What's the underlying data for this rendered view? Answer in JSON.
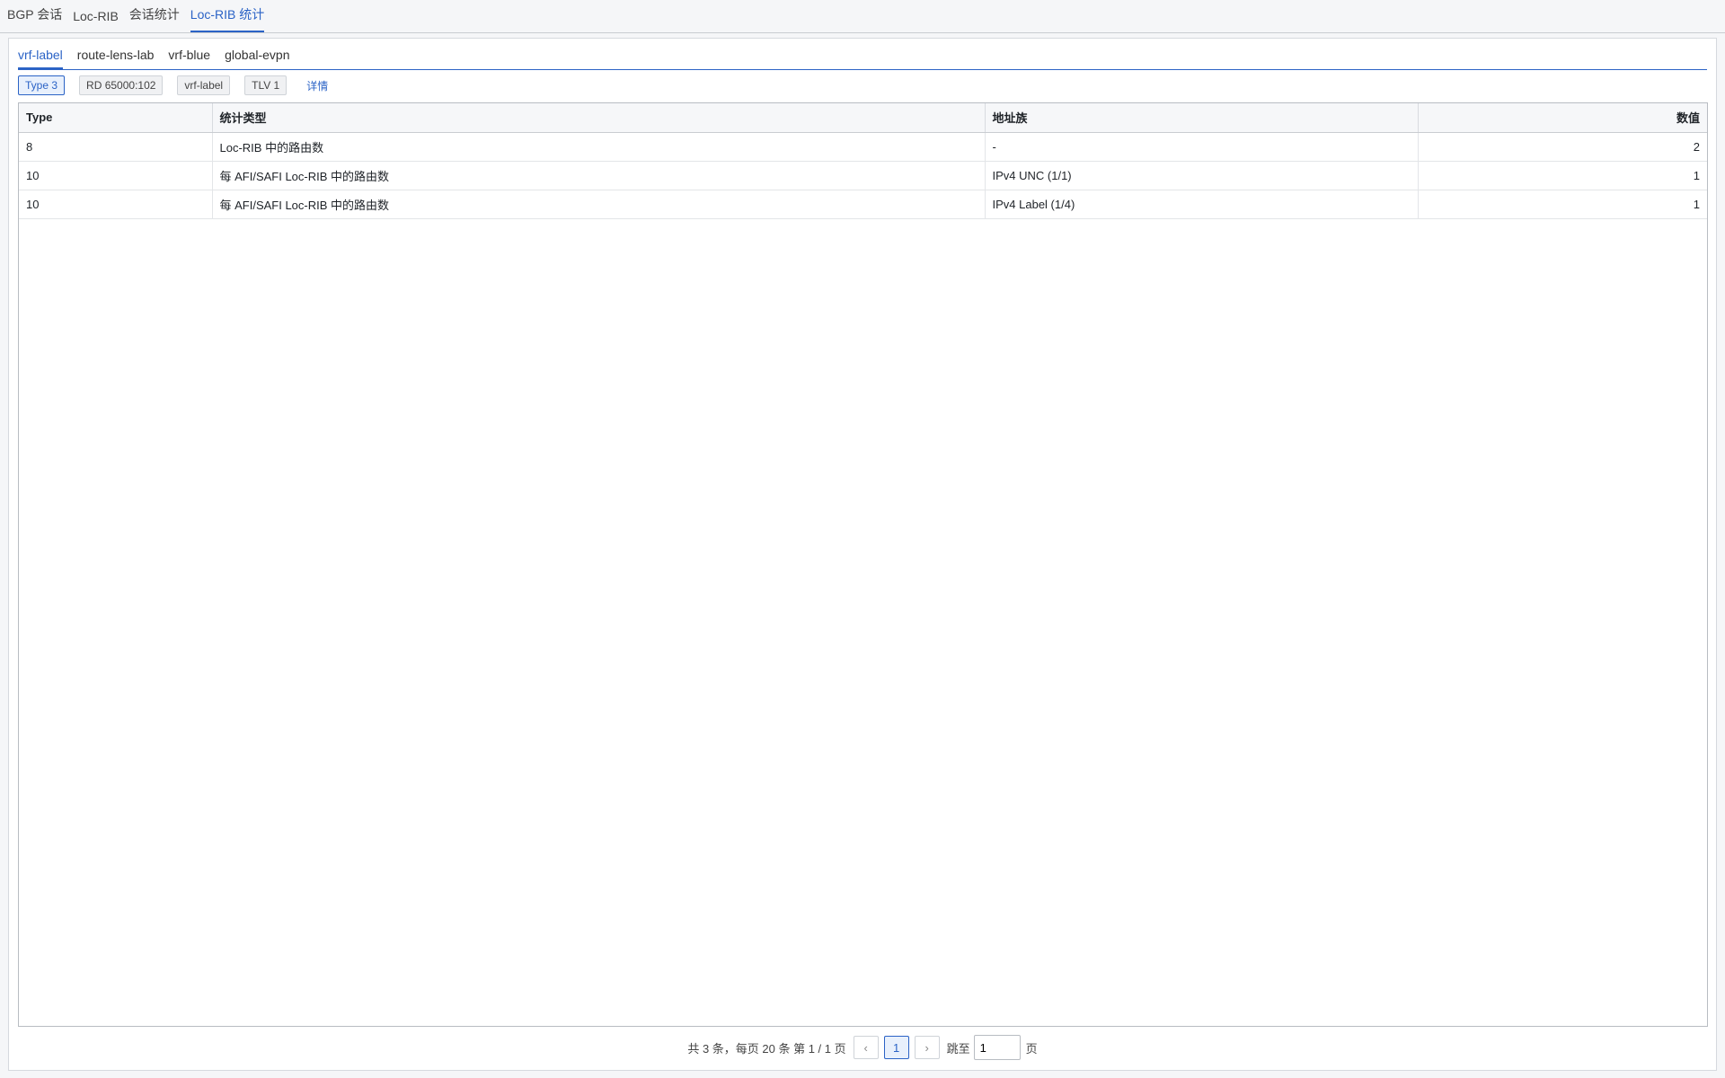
{
  "top_tabs": [
    {
      "label": "BGP 会话"
    },
    {
      "label": "Loc-RIB"
    },
    {
      "label": "会话统计"
    },
    {
      "label": "Loc-RIB 统计"
    }
  ],
  "sub_tabs": [
    {
      "label": "vrf-label"
    },
    {
      "label": "route-lens-lab"
    },
    {
      "label": "vrf-blue"
    },
    {
      "label": "global-evpn"
    }
  ],
  "chips": {
    "type": "Type 3",
    "rd": "RD 65000:102",
    "vrf": "vrf-label",
    "tlv": "TLV 1",
    "details_link": "详情"
  },
  "table": {
    "headers": [
      "Type",
      "统计类型",
      "地址族",
      "数值"
    ],
    "rows": [
      [
        "8",
        "Loc-RIB 中的路由数",
        "-",
        "2"
      ],
      [
        "10",
        "每 AFI/SAFI Loc-RIB 中的路由数",
        "IPv4 UNC (1/1)",
        "1"
      ],
      [
        "10",
        "每 AFI/SAFI Loc-RIB 中的路由数",
        "IPv4 Label (1/4)",
        "1"
      ]
    ]
  },
  "pagination": {
    "info": "共 3 条，每页 20 条  第 1 / 1 页",
    "prev": "‹",
    "current_page": "1",
    "next": "›",
    "jump_label": "跳至",
    "jump_value": "1",
    "page_suffix": "页"
  },
  "colors": {
    "accent": "#2b63c6"
  }
}
